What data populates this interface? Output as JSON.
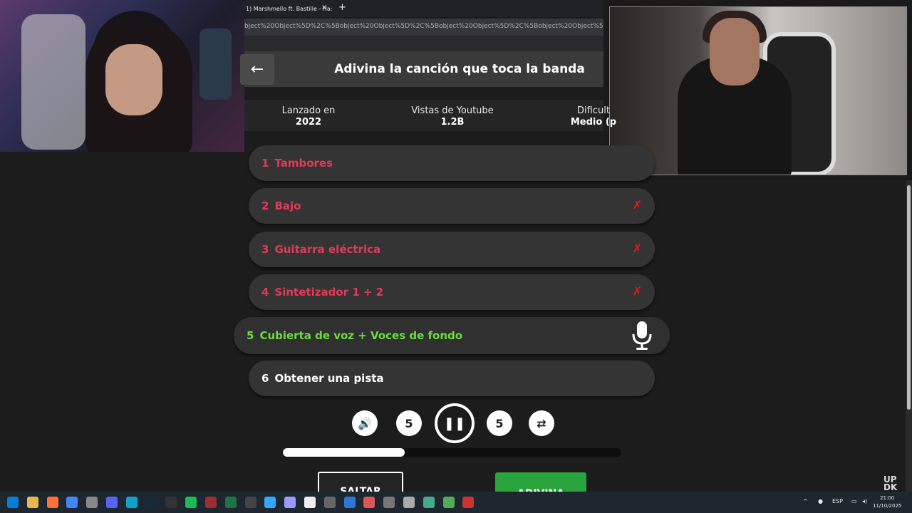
{
  "browser": {
    "tab_title": "1) Marshmello ft. Bastille - Ha:",
    "tab_close": "×",
    "tab_new": "+",
    "url": "bject%20Object%5D%2C%5Bobject%20Object%5D%2C%5Bobject%20Object%5D%2C%5Bobject%20Object%5D%2C%5Bobject%20Object%5D%2C%5Bobjec"
  },
  "game": {
    "back": "←",
    "title": "Adivina la canción que toca la banda",
    "stats": [
      {
        "label": "Lanzado en",
        "value": "2022"
      },
      {
        "label": "Vistas de Youtube",
        "value": "1.2B"
      },
      {
        "label": "Dificult",
        "value": "Medio (p"
      }
    ],
    "tracks": [
      {
        "num": "1",
        "label": "Tambores",
        "state": "red"
      },
      {
        "num": "2",
        "label": "Bajo",
        "state": "red",
        "mark": "✗"
      },
      {
        "num": "3",
        "label": "Guitarra eléctrica",
        "state": "red",
        "mark": "✗"
      },
      {
        "num": "4",
        "label": "Sintetizador 1 + 2",
        "state": "red",
        "mark": "✗"
      },
      {
        "num": "5",
        "label": "Cubierta de voz + Voces de fondo",
        "state": "active"
      },
      {
        "num": "6",
        "label": "Obtener una pista",
        "state": "hint"
      }
    ],
    "controls": {
      "volume": "🔊",
      "rewind": "5",
      "play_pause": "❚❚",
      "forward": "5",
      "shuffle": "⇄"
    },
    "progress": 0.36,
    "skip_label": "SALTAR",
    "guess_label": "ADIVINA"
  },
  "watermark": "UP\nDK",
  "tray": {
    "lang": "ESP",
    "time": "21:00",
    "date": "11/10/2025"
  },
  "taskbar_icons": [
    "windows-icon",
    "file-explorer-icon",
    "firefox-icon",
    "chrome-icon",
    "settings-icon",
    "discord-icon",
    "edge-icon",
    "steam-icon",
    "capcut-icon",
    "spotify-icon",
    "app-icon",
    "excel-icon",
    "obs-icon",
    "photoshop-icon",
    "premiere-icon",
    "notepad-icon",
    "app2-icon",
    "network-icon",
    "browser2-icon",
    "app3-icon",
    "app4-icon",
    "app5-icon",
    "app6-icon",
    "app7-icon"
  ],
  "colors": {
    "wrong": "#e23a55",
    "active": "#6ddc3d",
    "guess": "#29a43c"
  }
}
